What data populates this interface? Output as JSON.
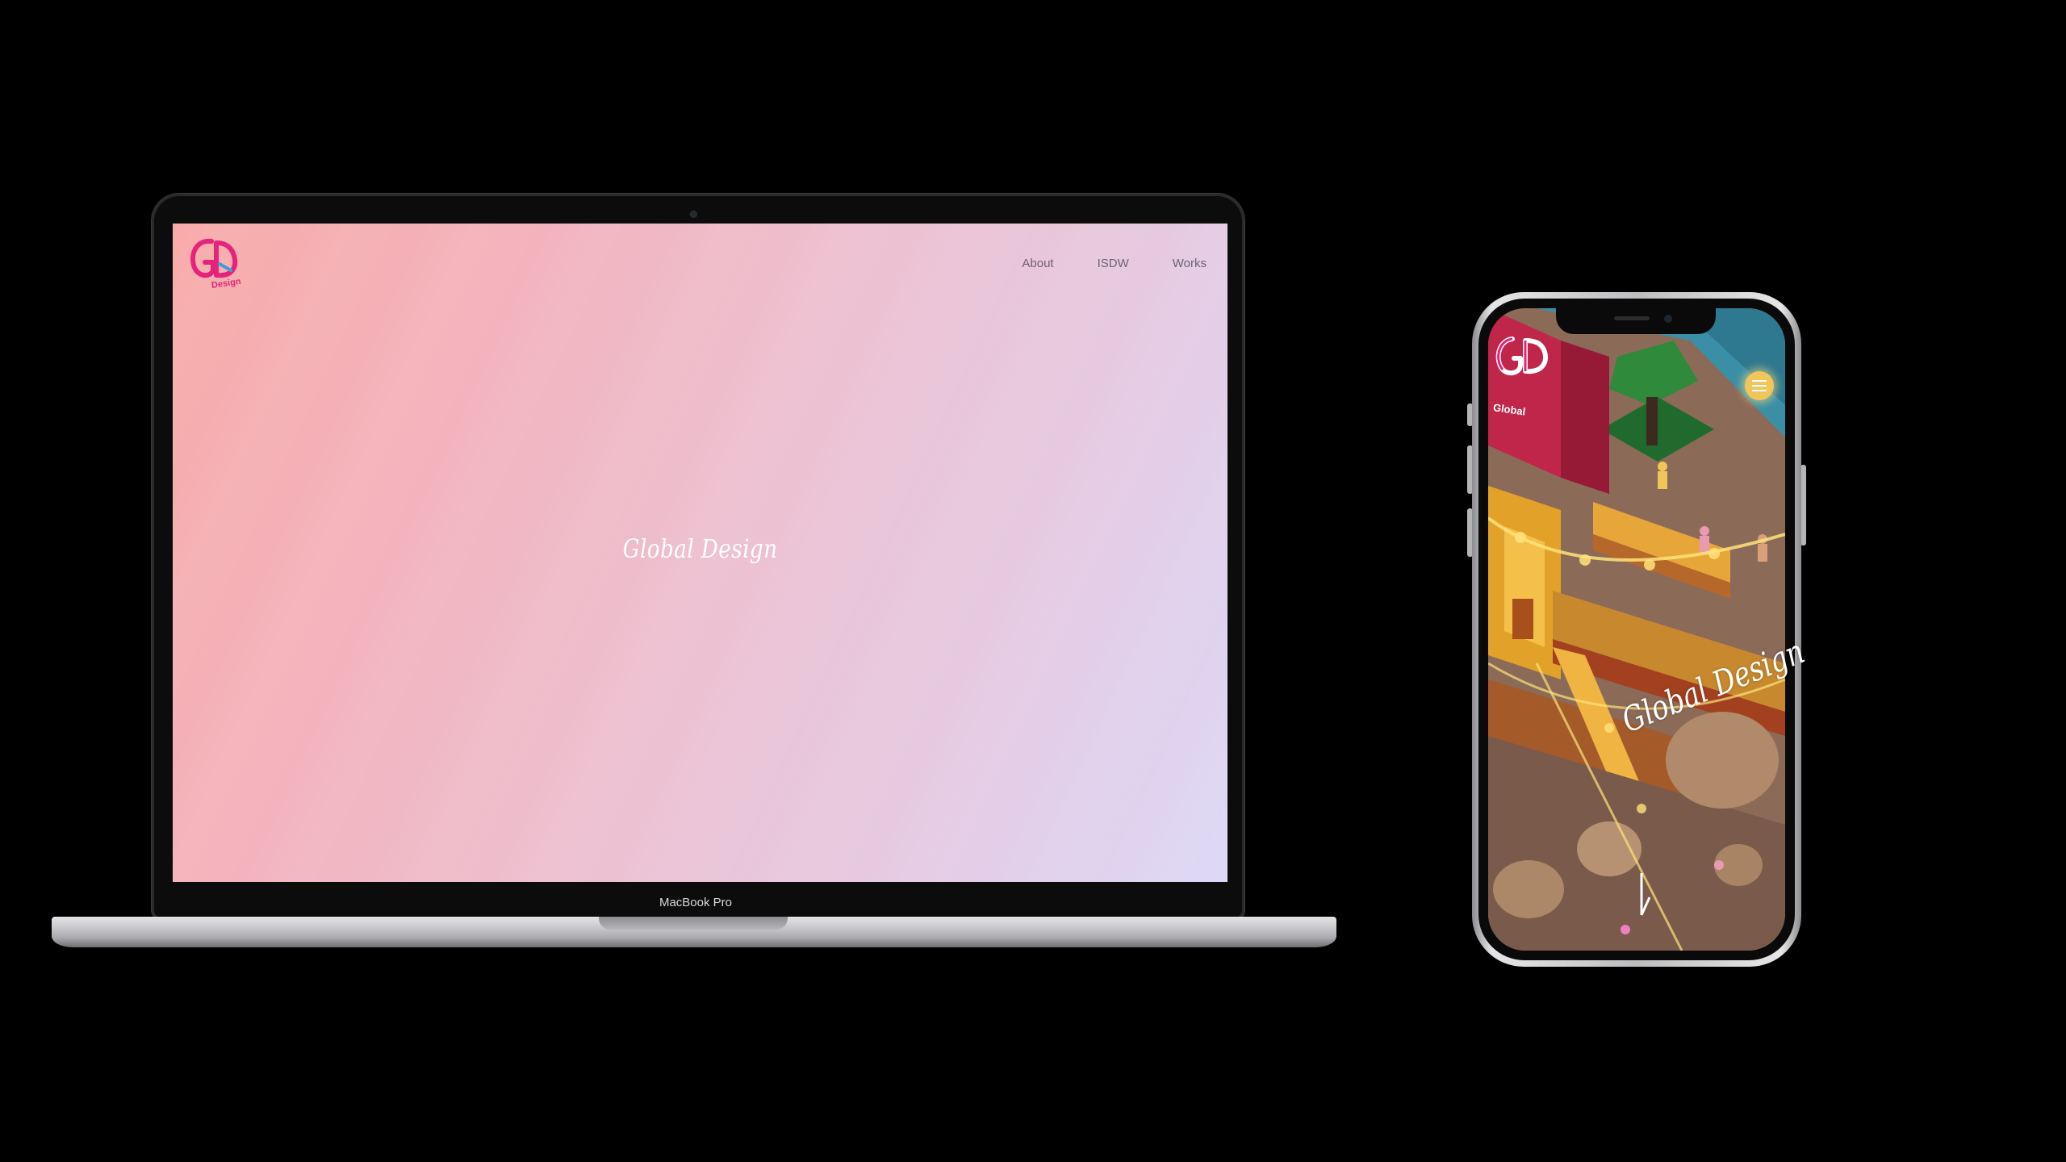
{
  "desktop": {
    "nav": [
      {
        "label": "About"
      },
      {
        "label": "ISDW"
      },
      {
        "label": "Works"
      }
    ],
    "hero_title": "Global Design",
    "logo_initials": "GD",
    "logo_subtext": "Design",
    "device_label": "MacBook Pro"
  },
  "mobile": {
    "hero_title": "Global Design",
    "logo_initials": "GD",
    "logo_subtext": "Global",
    "menu_icon": "hamburger-menu-icon"
  },
  "colors": {
    "gradient_start": "#f8aaa8",
    "gradient_end": "#dcd8f6",
    "logo_pink": "#e6227c",
    "nav_text": "#6e6272",
    "phone_menu": "#f2c55a"
  }
}
